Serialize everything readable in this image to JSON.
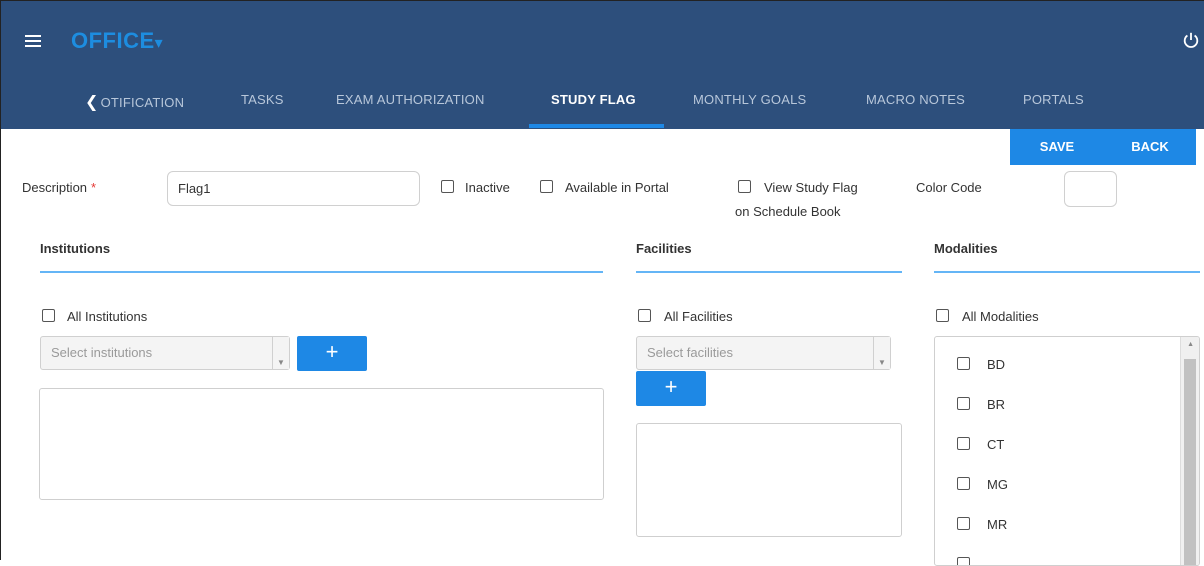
{
  "header": {
    "brand": "OFFICE",
    "brand_caret": "▾",
    "tabs": [
      {
        "label": "OTIFICATION"
      },
      {
        "label": "TASKS"
      },
      {
        "label": "EXAM AUTHORIZATION"
      },
      {
        "label": "STUDY FLAG"
      },
      {
        "label": "MONTHLY GOALS"
      },
      {
        "label": "MACRO NOTES"
      },
      {
        "label": "PORTALS"
      }
    ],
    "active_tab": "STUDY FLAG",
    "colors": {
      "bar": "#2d4f7c",
      "accent": "#1e88e5",
      "brand": "#1d8de0"
    }
  },
  "actions": {
    "save": "SAVE",
    "back": "BACK"
  },
  "form": {
    "description_label": "Description",
    "required_mark": "*",
    "description_value": "Flag1",
    "inactive_label": "Inactive",
    "available_label": "Available in Portal",
    "view_flag_line1": "View Study Flag",
    "view_flag_line2": "on Schedule Book",
    "color_code_label": "Color Code"
  },
  "institutions": {
    "title": "Institutions",
    "all_label": "All Institutions",
    "placeholder": "Select institutions",
    "add": "+"
  },
  "facilities": {
    "title": "Facilities",
    "all_label": "All Facilities",
    "placeholder": "Select facilities",
    "add": "+"
  },
  "modalities": {
    "title": "Modalities",
    "all_label": "All Modalities",
    "items": [
      "BD",
      "BR",
      "CT",
      "MG",
      "MR"
    ]
  }
}
